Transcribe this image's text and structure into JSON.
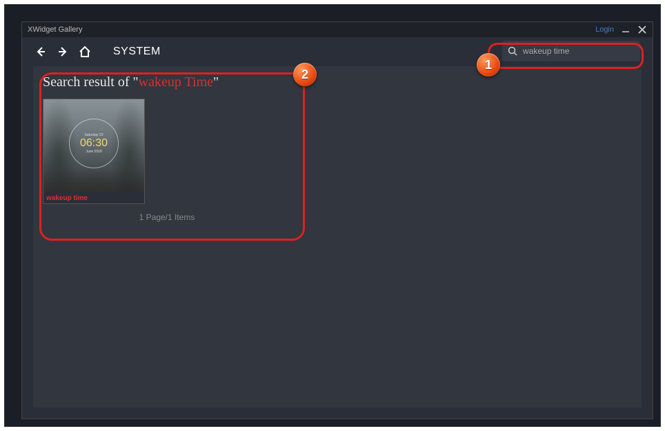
{
  "window": {
    "title": "XWidget Gallery",
    "login_label": "Login"
  },
  "nav": {
    "page_label": "SYSTEM"
  },
  "search": {
    "value": "wakeup time"
  },
  "results": {
    "heading_prefix": "Search result of \"",
    "heading_term": "wakeup Time",
    "heading_suffix": "\"",
    "items": [
      {
        "name": "wakeup time",
        "clock": {
          "day": "Saturday 23",
          "time": "06:30",
          "month": "June 2018"
        }
      }
    ],
    "pagination": "1 Page/1 Items"
  },
  "callouts": {
    "b1": "1",
    "b2": "2"
  }
}
